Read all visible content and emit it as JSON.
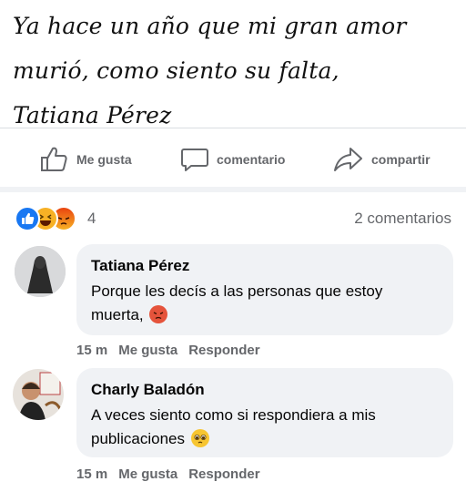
{
  "post": {
    "lines": [
      "Ya hace un año que mi gran amor",
      "murió, como siento su falta,",
      "Tatiana Pérez"
    ]
  },
  "actions": {
    "like": "Me gusta",
    "comment": "comentario",
    "share": "compartir"
  },
  "reactions": {
    "icons": [
      "like-icon",
      "haha-icon",
      "angry-icon"
    ],
    "count": "4",
    "comments_count": "2 comentarios"
  },
  "comments": [
    {
      "author": "Tatiana Pérez",
      "text_line1": "Porque les decís a las personas que estoy",
      "text_line2": "muerta,",
      "emoji": "angry-face-emoji",
      "time": "15 m",
      "like": "Me gusta",
      "reply": "Responder"
    },
    {
      "author": "Charly Baladón",
      "text_line1": "A veces siento como si respondiera a mis",
      "text_line2": "publicaciones",
      "emoji": "pleading-face-emoji",
      "time": "15 m",
      "like": "Me gusta",
      "reply": "Responder"
    }
  ],
  "colors": {
    "like_blue": "#1877f2",
    "bubble_bg": "#f0f2f5",
    "muted_text": "#65676b"
  }
}
